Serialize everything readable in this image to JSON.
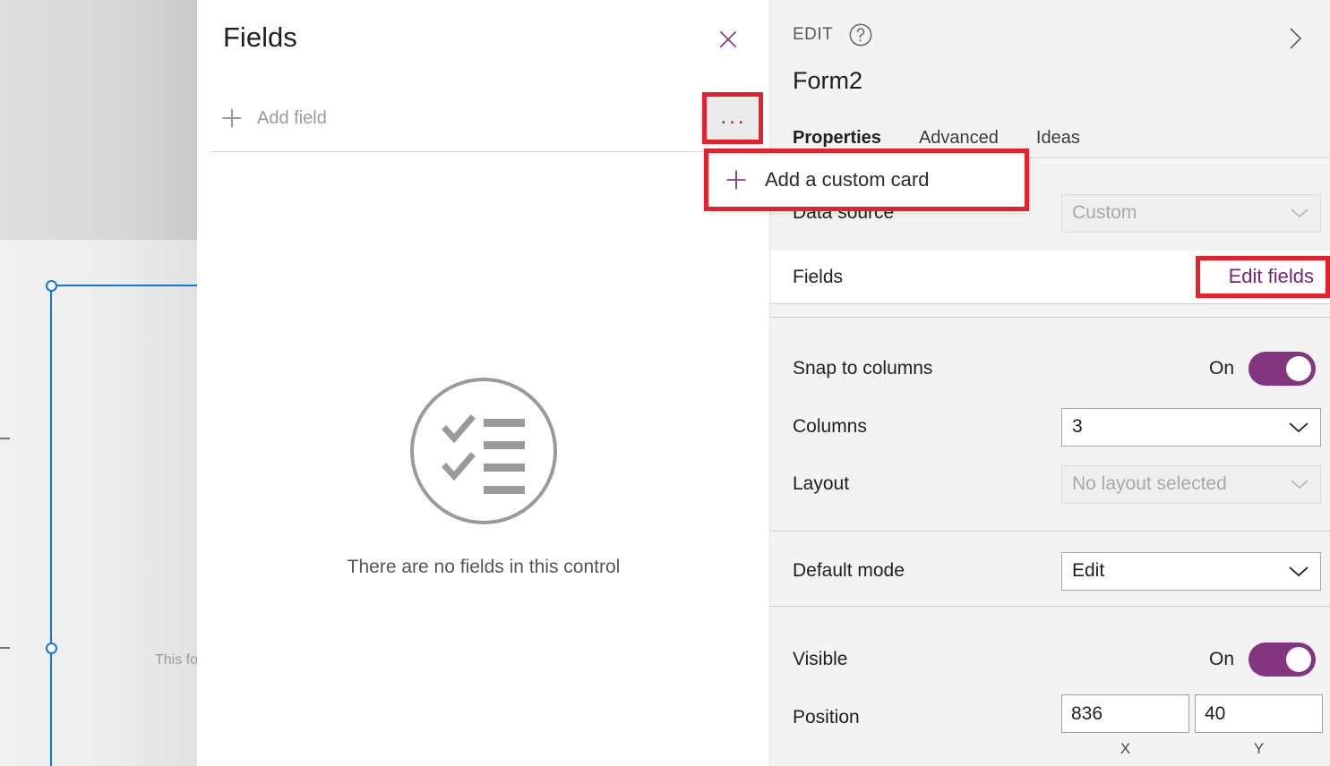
{
  "canvas": {
    "hint_text": "This fo",
    "selection_color": "#1177d1"
  },
  "fields_panel": {
    "title": "Fields",
    "close_icon": "close-icon",
    "add_field": {
      "label": "Add field",
      "icon": "plus-icon"
    },
    "overflow_button": {
      "icon": "ellipsis-icon",
      "label": "..."
    },
    "empty_state": {
      "icon": "checklist-circle-icon",
      "text": "There are no fields in this control"
    }
  },
  "flyout_menu": {
    "items": [
      {
        "label": "Add a custom card",
        "icon": "plus-icon"
      }
    ]
  },
  "properties_panel": {
    "edit_label": "EDIT",
    "help_icon": "question-circle-icon",
    "collapse_icon": "chevron-right-icon",
    "control_name": "Form2",
    "tabs": [
      {
        "label": "Properties",
        "active": true
      },
      {
        "label": "Advanced",
        "active": false
      },
      {
        "label": "Ideas",
        "active": false
      }
    ],
    "rows": {
      "data_source": {
        "label": "Data source",
        "value": "Custom",
        "disabled": true
      },
      "fields": {
        "label": "Fields",
        "action_label": "Edit fields"
      },
      "snap_to_columns": {
        "label": "Snap to columns",
        "state": "On"
      },
      "columns": {
        "label": "Columns",
        "value": "3"
      },
      "layout": {
        "label": "Layout",
        "value": "No layout selected",
        "disabled": true
      },
      "default_mode": {
        "label": "Default mode",
        "value": "Edit"
      },
      "visible": {
        "label": "Visible",
        "state": "On"
      },
      "position": {
        "label": "Position",
        "x_value": "836",
        "y_value": "40",
        "x_axis_label": "X",
        "y_axis_label": "Y"
      }
    }
  },
  "colors": {
    "accent_purple": "#742774",
    "toggle_on": "#84357f",
    "annotation_red": "#e8202a",
    "selection_blue": "#1177d1",
    "panel_bg": "#f3f3f3"
  }
}
